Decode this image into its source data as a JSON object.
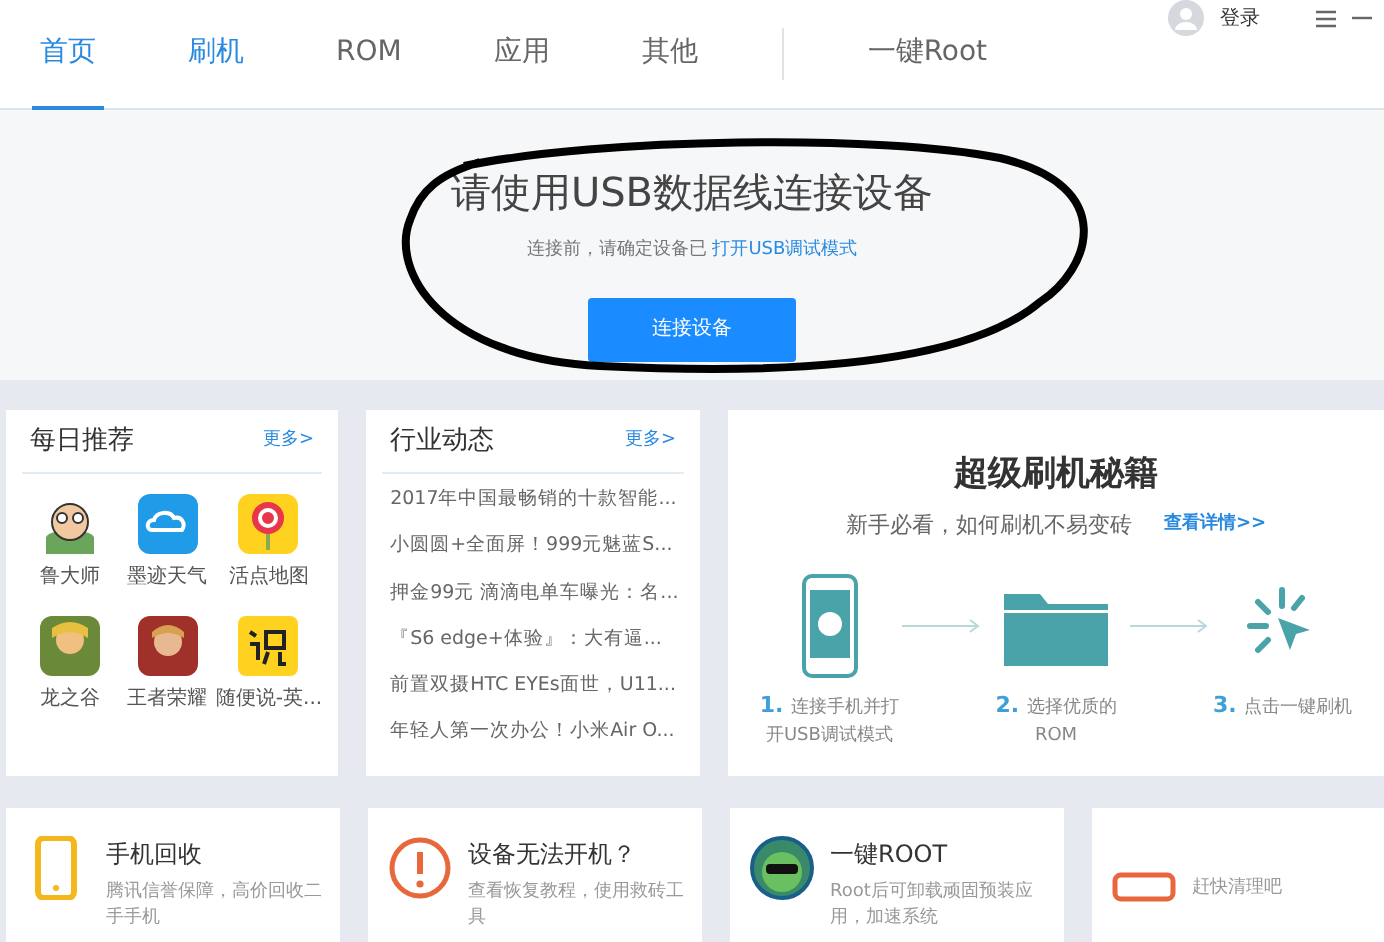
{
  "nav": {
    "tabs": [
      {
        "label": "首页",
        "selected": true,
        "hover": false
      },
      {
        "label": "刷机",
        "selected": false,
        "hover": true
      },
      {
        "label": "ROM",
        "selected": false,
        "hover": false
      },
      {
        "label": "应用",
        "selected": false,
        "hover": false
      },
      {
        "label": "其他",
        "selected": false,
        "hover": false
      }
    ],
    "root_link": "一键Root",
    "login": "登录"
  },
  "hero": {
    "title": "请使用USB数据线连接设备",
    "hint": "连接前，请确定设备已",
    "hint_link": "打开USB调试模式",
    "button": "连接设备"
  },
  "daily": {
    "title": "每日推荐",
    "more": "更多>",
    "apps": [
      {
        "name": "鲁大师"
      },
      {
        "name": "墨迹天气"
      },
      {
        "name": "活点地图"
      },
      {
        "name": "龙之谷"
      },
      {
        "name": "王者荣耀"
      },
      {
        "name": "随便说-英..."
      }
    ]
  },
  "news": {
    "title": "行业动态",
    "more": "更多>",
    "items": [
      "2017年中国最畅销的十款智能...",
      "小圆圆+全面屏！999元魅蓝S...",
      "押金99元 滴滴电单车曝光：名...",
      "『S6 edge+体验』：大有逼...",
      "前置双摄HTC EYEs面世，U11...",
      "年轻人第一次办公！小米Air O..."
    ]
  },
  "guide": {
    "title": "超级刷机秘籍",
    "subtitle": "新手必看，如何刷机不易变砖",
    "link": "查看详情>>",
    "steps": [
      {
        "num": "1.",
        "text": "连接手机并打开USB调试模式"
      },
      {
        "num": "2.",
        "text": "选择优质的ROM"
      },
      {
        "num": "3.",
        "text": "点击一键刷机"
      }
    ]
  },
  "bottom_cards": [
    {
      "title": "手机回收",
      "desc": "腾讯信誉保障，高价回收二手手机"
    },
    {
      "title": "设备无法开机？",
      "desc": "查看恢复教程，使用救砖工具"
    },
    {
      "title": "一键ROOT",
      "desc": "Root后可卸载顽固预装应用，加速系统"
    },
    {
      "desc": "赶快清理吧"
    }
  ]
}
